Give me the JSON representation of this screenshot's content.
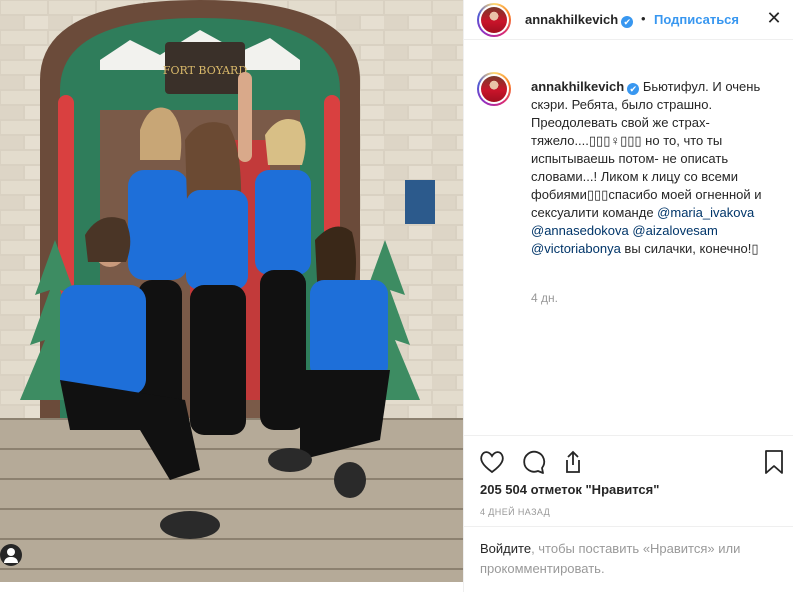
{
  "post": {
    "username": "annakhilkevich",
    "verified_mark": "✔",
    "separator": "•",
    "follow_label": "Подписаться",
    "close_glyph": "✕"
  },
  "caption": {
    "username": "annakhilkevich",
    "verified_mark": "✔",
    "text_1": " Бьютифул. И очень скэри. Ребята, было страшно. Преодолевать свой же страх- тяжело....▯▯▯♀▯▯▯ но то, что ты испытываешь потом- не описать словами...! Ликом к лицу со всеми фобиями▯▯▯спасибо моей огненной и сексуалити команде ",
    "mention_1": "@maria_ivakova",
    "gap_1": " ",
    "mention_2": "@annasedokova",
    "gap_2": " ",
    "mention_3": "@aizalovesam",
    "gap_3": " ",
    "mention_4": "@victoriabonya",
    "text_2": " вы силачки, конечно!▯",
    "time": "4 дн."
  },
  "actions": {
    "icons": [
      "heart-icon",
      "comment-icon",
      "share-icon",
      "bookmark-icon"
    ],
    "likes": "205 504 отметок \"Нравится\"",
    "posted": "4 ДНЕЙ НАЗАД"
  },
  "login": {
    "link": "Войдите",
    "text": ", чтобы поставить «Нравится» или прокомментировать."
  },
  "photo": {
    "sign_text": "FORT BOYARD"
  },
  "colors": {
    "accent": "#3897f0",
    "mention": "#003569",
    "muted": "#999999",
    "jersey_blue": "#1e6fd9"
  }
}
